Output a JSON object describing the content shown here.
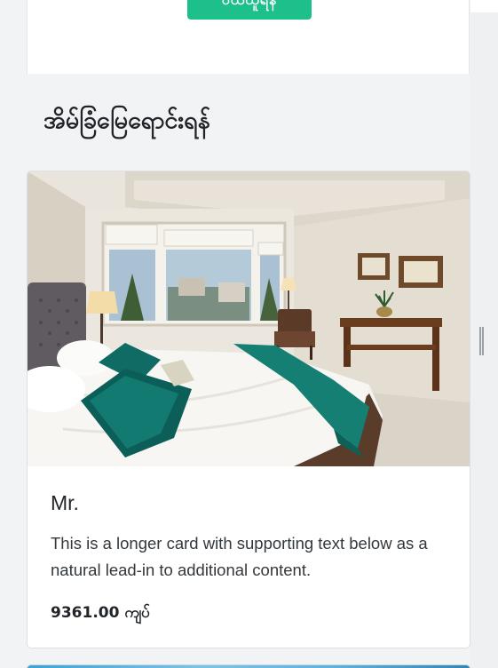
{
  "header": {
    "button_label": "ဝယ်ယူရန်"
  },
  "section": {
    "title": "အိမ်ခြံမြေရောင်းရန်"
  },
  "card": {
    "image_icon": "bedroom-photo",
    "title": "Mr.",
    "text": "This is a longer card with supporting text below as a natural lead-in to additional content.",
    "price": "9361.00 ကျပ်"
  },
  "colors": {
    "accent_button": "#1dbf8a",
    "page_background": "#f2f3f5",
    "card_background": "#ffffff",
    "teal_bedding": "#0f6b64"
  }
}
